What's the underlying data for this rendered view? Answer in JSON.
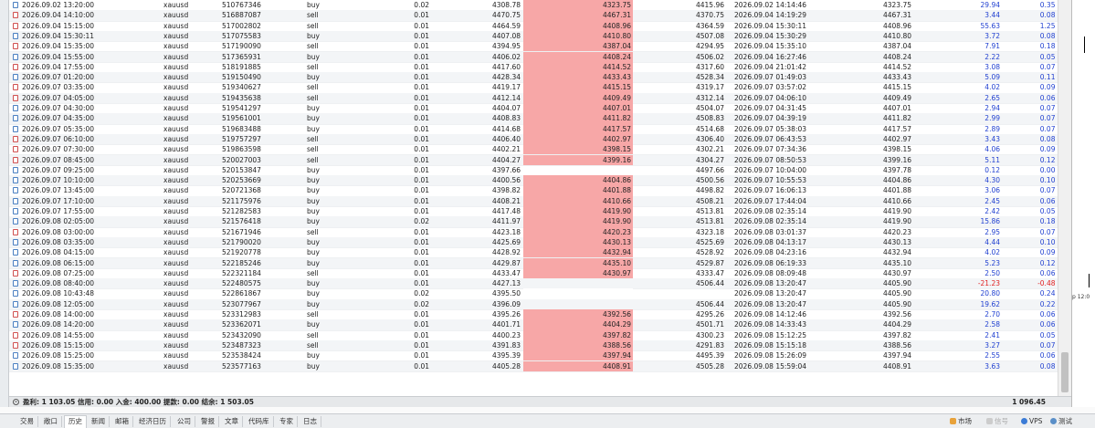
{
  "rows": [
    {
      "time": "2026.09.02 13:20:00",
      "symbol": "xauusd",
      "ticket": "510767346",
      "type": "buy",
      "volume": "0.02",
      "price": "4308.78",
      "sl": "4323.75",
      "tp": "4415.96",
      "ctime": "2026.09.02 14:14:46",
      "cprice": "4323.75",
      "profit": "29.94",
      "pct": "0.35 %",
      "hl": true
    },
    {
      "time": "2026.09.04 14:10:00",
      "symbol": "xauusd",
      "ticket": "516887087",
      "type": "sell",
      "volume": "0.01",
      "price": "4470.75",
      "sl": "4467.31",
      "tp": "4370.75",
      "ctime": "2026.09.04 14:19:29",
      "cprice": "4467.31",
      "profit": "3.44",
      "pct": "0.08 %",
      "hl": true
    },
    {
      "time": "2026.09.04 15:15:00",
      "symbol": "xauusd",
      "ticket": "517002802",
      "type": "sell",
      "volume": "0.01",
      "price": "4464.59",
      "sl": "4408.96",
      "tp": "4364.59",
      "ctime": "2026.09.04 15:30:11",
      "cprice": "4408.96",
      "profit": "55.63",
      "pct": "1.25 %",
      "hl": true
    },
    {
      "time": "2026.09.04 15:30:11",
      "symbol": "xauusd",
      "ticket": "517075583",
      "type": "buy",
      "volume": "0.01",
      "price": "4407.08",
      "sl": "4410.80",
      "tp": "4507.08",
      "ctime": "2026.09.04 15:30:29",
      "cprice": "4410.80",
      "profit": "3.72",
      "pct": "0.08 %",
      "hl": true
    },
    {
      "time": "2026.09.04 15:35:00",
      "symbol": "xauusd",
      "ticket": "517190090",
      "type": "sell",
      "volume": "0.01",
      "price": "4394.95",
      "sl": "4387.04",
      "tp": "4294.95",
      "ctime": "2026.09.04 15:35:10",
      "cprice": "4387.04",
      "profit": "7.91",
      "pct": "0.18 %",
      "hl": true
    },
    {
      "time": "2026.09.04 15:55:00",
      "symbol": "xauusd",
      "ticket": "517365931",
      "type": "buy",
      "volume": "0.01",
      "price": "4406.02",
      "sl": "4408.24",
      "tp": "4506.02",
      "ctime": "2026.09.04 16:27:46",
      "cprice": "4408.24",
      "profit": "2.22",
      "pct": "0.05 %",
      "hl": true
    },
    {
      "time": "2026.09.04 17:55:00",
      "symbol": "xauusd",
      "ticket": "518191885",
      "type": "sell",
      "volume": "0.01",
      "price": "4417.60",
      "sl": "4414.52",
      "tp": "4317.60",
      "ctime": "2026.09.04 21:01:42",
      "cprice": "4414.52",
      "profit": "3.08",
      "pct": "0.07 %",
      "hl": true
    },
    {
      "time": "2026.09.07 01:20:00",
      "symbol": "xauusd",
      "ticket": "519150490",
      "type": "buy",
      "volume": "0.01",
      "price": "4428.34",
      "sl": "4433.43",
      "tp": "4528.34",
      "ctime": "2026.09.07 01:49:03",
      "cprice": "4433.43",
      "profit": "5.09",
      "pct": "0.11 %",
      "hl": true
    },
    {
      "time": "2026.09.07 03:35:00",
      "symbol": "xauusd",
      "ticket": "519340627",
      "type": "sell",
      "volume": "0.01",
      "price": "4419.17",
      "sl": "4415.15",
      "tp": "4319.17",
      "ctime": "2026.09.07 03:57:02",
      "cprice": "4415.15",
      "profit": "4.02",
      "pct": "0.09 %",
      "hl": true
    },
    {
      "time": "2026.09.07 04:05:00",
      "symbol": "xauusd",
      "ticket": "519435638",
      "type": "sell",
      "volume": "0.01",
      "price": "4412.14",
      "sl": "4409.49",
      "tp": "4312.14",
      "ctime": "2026.09.07 04:06:10",
      "cprice": "4409.49",
      "profit": "2.65",
      "pct": "0.06 %",
      "hl": true
    },
    {
      "time": "2026.09.07 04:30:00",
      "symbol": "xauusd",
      "ticket": "519541297",
      "type": "buy",
      "volume": "0.01",
      "price": "4404.07",
      "sl": "4407.01",
      "tp": "4504.07",
      "ctime": "2026.09.07 04:31:45",
      "cprice": "4407.01",
      "profit": "2.94",
      "pct": "0.07 %",
      "hl": true
    },
    {
      "time": "2026.09.07 04:35:00",
      "symbol": "xauusd",
      "ticket": "519561001",
      "type": "buy",
      "volume": "0.01",
      "price": "4408.83",
      "sl": "4411.82",
      "tp": "4508.83",
      "ctime": "2026.09.07 04:39:19",
      "cprice": "4411.82",
      "profit": "2.99",
      "pct": "0.07 %",
      "hl": true
    },
    {
      "time": "2026.09.07 05:35:00",
      "symbol": "xauusd",
      "ticket": "519683488",
      "type": "buy",
      "volume": "0.01",
      "price": "4414.68",
      "sl": "4417.57",
      "tp": "4514.68",
      "ctime": "2026.09.07 05:38:03",
      "cprice": "4417.57",
      "profit": "2.89",
      "pct": "0.07 %",
      "hl": true
    },
    {
      "time": "2026.09.07 06:10:00",
      "symbol": "xauusd",
      "ticket": "519757297",
      "type": "sell",
      "volume": "0.01",
      "price": "4406.40",
      "sl": "4402.97",
      "tp": "4306.40",
      "ctime": "2026.09.07 06:43:53",
      "cprice": "4402.97",
      "profit": "3.43",
      "pct": "0.08 %",
      "hl": true
    },
    {
      "time": "2026.09.07 07:30:00",
      "symbol": "xauusd",
      "ticket": "519863598",
      "type": "sell",
      "volume": "0.01",
      "price": "4402.21",
      "sl": "4398.15",
      "tp": "4302.21",
      "ctime": "2026.09.07 07:34:36",
      "cprice": "4398.15",
      "profit": "4.06",
      "pct": "0.09 %",
      "hl": true
    },
    {
      "time": "2026.09.07 08:45:00",
      "symbol": "xauusd",
      "ticket": "520027003",
      "type": "sell",
      "volume": "0.01",
      "price": "4404.27",
      "sl": "4399.16",
      "tp": "4304.27",
      "ctime": "2026.09.07 08:50:53",
      "cprice": "4399.16",
      "profit": "5.11",
      "pct": "0.12 %",
      "hl": true
    },
    {
      "time": "2026.09.07 09:25:00",
      "symbol": "xauusd",
      "ticket": "520153847",
      "type": "buy",
      "volume": "0.01",
      "price": "4397.66",
      "sl": "",
      "tp": "4497.66",
      "ctime": "2026.09.07 10:04:00",
      "cprice": "4397.78",
      "profit": "0.12",
      "pct": "0.00 %",
      "hl": false
    },
    {
      "time": "2026.09.07 10:10:00",
      "symbol": "xauusd",
      "ticket": "520253669",
      "type": "buy",
      "volume": "0.01",
      "price": "4400.56",
      "sl": "4404.86",
      "tp": "4500.56",
      "ctime": "2026.09.07 10:55:53",
      "cprice": "4404.86",
      "profit": "4.30",
      "pct": "0.10 %",
      "hl": true
    },
    {
      "time": "2026.09.07 13:45:00",
      "symbol": "xauusd",
      "ticket": "520721368",
      "type": "buy",
      "volume": "0.01",
      "price": "4398.82",
      "sl": "4401.88",
      "tp": "4498.82",
      "ctime": "2026.09.07 16:06:13",
      "cprice": "4401.88",
      "profit": "3.06",
      "pct": "0.07 %",
      "hl": true
    },
    {
      "time": "2026.09.07 17:10:00",
      "symbol": "xauusd",
      "ticket": "521175976",
      "type": "buy",
      "volume": "0.01",
      "price": "4408.21",
      "sl": "4410.66",
      "tp": "4508.21",
      "ctime": "2026.09.07 17:44:04",
      "cprice": "4410.66",
      "profit": "2.45",
      "pct": "0.06 %",
      "hl": true
    },
    {
      "time": "2026.09.07 17:55:00",
      "symbol": "xauusd",
      "ticket": "521282583",
      "type": "buy",
      "volume": "0.01",
      "price": "4417.48",
      "sl": "4419.90",
      "tp": "4513.81",
      "ctime": "2026.09.08 02:35:14",
      "cprice": "4419.90",
      "profit": "2.42",
      "pct": "0.05 %",
      "hl": true
    },
    {
      "time": "2026.09.08 02:05:00",
      "symbol": "xauusd",
      "ticket": "521576418",
      "type": "buy",
      "volume": "0.02",
      "price": "4411.97",
      "sl": "4419.90",
      "tp": "4513.81",
      "ctime": "2026.09.08 02:35:14",
      "cprice": "4419.90",
      "profit": "15.86",
      "pct": "0.18 %",
      "hl": true
    },
    {
      "time": "2026.09.08 03:00:00",
      "symbol": "xauusd",
      "ticket": "521671946",
      "type": "sell",
      "volume": "0.01",
      "price": "4423.18",
      "sl": "4420.23",
      "tp": "4323.18",
      "ctime": "2026.09.08 03:01:37",
      "cprice": "4420.23",
      "profit": "2.95",
      "pct": "0.07 %",
      "hl": true
    },
    {
      "time": "2026.09.08 03:35:00",
      "symbol": "xauusd",
      "ticket": "521790020",
      "type": "buy",
      "volume": "0.01",
      "price": "4425.69",
      "sl": "4430.13",
      "tp": "4525.69",
      "ctime": "2026.09.08 04:13:17",
      "cprice": "4430.13",
      "profit": "4.44",
      "pct": "0.10 %",
      "hl": true
    },
    {
      "time": "2026.09.08 04:15:00",
      "symbol": "xauusd",
      "ticket": "521920778",
      "type": "buy",
      "volume": "0.01",
      "price": "4428.92",
      "sl": "4432.94",
      "tp": "4528.92",
      "ctime": "2026.09.08 04:23:16",
      "cprice": "4432.94",
      "profit": "4.02",
      "pct": "0.09 %",
      "hl": true
    },
    {
      "time": "2026.09.08 06:15:00",
      "symbol": "xauusd",
      "ticket": "522185246",
      "type": "buy",
      "volume": "0.01",
      "price": "4429.87",
      "sl": "4435.10",
      "tp": "4529.87",
      "ctime": "2026.09.08 06:19:33",
      "cprice": "4435.10",
      "profit": "5.23",
      "pct": "0.12 %",
      "hl": true
    },
    {
      "time": "2026.09.08 07:25:00",
      "symbol": "xauusd",
      "ticket": "522321184",
      "type": "sell",
      "volume": "0.01",
      "price": "4433.47",
      "sl": "4430.97",
      "tp": "4333.47",
      "ctime": "2026.09.08 08:09:48",
      "cprice": "4430.97",
      "profit": "2.50",
      "pct": "0.06 %",
      "hl": true
    },
    {
      "time": "2026.09.08 08:40:00",
      "symbol": "xauusd",
      "ticket": "522480575",
      "type": "buy",
      "volume": "0.01",
      "price": "4427.13",
      "sl": "",
      "tp": "4506.44",
      "ctime": "2026.09.08 13:20:47",
      "cprice": "4405.90",
      "profit": "-21.23",
      "pct": "-0.48 %",
      "hl": false,
      "neg": true
    },
    {
      "time": "2026.09.08 10:43:48",
      "symbol": "xauusd",
      "ticket": "522861867",
      "type": "buy",
      "volume": "0.02",
      "price": "4395.50",
      "sl": "",
      "tp": "",
      "ctime": "2026.09.08 13:20:47",
      "cprice": "4405.90",
      "profit": "20.80",
      "pct": "0.24 %",
      "hl": false,
      "wh": true
    },
    {
      "time": "2026.09.08 12:05:00",
      "symbol": "xauusd",
      "ticket": "523077967",
      "type": "buy",
      "volume": "0.02",
      "price": "4396.09",
      "sl": "",
      "tp": "4506.44",
      "ctime": "2026.09.08 13:20:47",
      "cprice": "4405.90",
      "profit": "19.62",
      "pct": "0.22 %",
      "hl": false
    },
    {
      "time": "2026.09.08 14:00:00",
      "symbol": "xauusd",
      "ticket": "523312983",
      "type": "sell",
      "volume": "0.01",
      "price": "4395.26",
      "sl": "4392.56",
      "tp": "4295.26",
      "ctime": "2026.09.08 14:12:46",
      "cprice": "4392.56",
      "profit": "2.70",
      "pct": "0.06 %",
      "hl": true
    },
    {
      "time": "2026.09.08 14:20:00",
      "symbol": "xauusd",
      "ticket": "523362071",
      "type": "buy",
      "volume": "0.01",
      "price": "4401.71",
      "sl": "4404.29",
      "tp": "4501.71",
      "ctime": "2026.09.08 14:33:43",
      "cprice": "4404.29",
      "profit": "2.58",
      "pct": "0.06 %",
      "hl": true
    },
    {
      "time": "2026.09.08 14:55:00",
      "symbol": "xauusd",
      "ticket": "523432090",
      "type": "sell",
      "volume": "0.01",
      "price": "4400.23",
      "sl": "4397.82",
      "tp": "4300.23",
      "ctime": "2026.09.08 15:12:25",
      "cprice": "4397.82",
      "profit": "2.41",
      "pct": "0.05 %",
      "hl": true
    },
    {
      "time": "2026.09.08 15:15:00",
      "symbol": "xauusd",
      "ticket": "523487323",
      "type": "sell",
      "volume": "0.01",
      "price": "4391.83",
      "sl": "4388.56",
      "tp": "4291.83",
      "ctime": "2026.09.08 15:15:18",
      "cprice": "4388.56",
      "profit": "3.27",
      "pct": "0.07 %",
      "hl": true
    },
    {
      "time": "2026.09.08 15:25:00",
      "symbol": "xauusd",
      "ticket": "523538424",
      "type": "buy",
      "volume": "0.01",
      "price": "4395.39",
      "sl": "4397.94",
      "tp": "4495.39",
      "ctime": "2026.09.08 15:26:09",
      "cprice": "4397.94",
      "profit": "2.55",
      "pct": "0.06 %",
      "hl": true
    },
    {
      "time": "2026.09.08 15:35:00",
      "symbol": "xauusd",
      "ticket": "523577163",
      "type": "buy",
      "volume": "0.01",
      "price": "4405.28",
      "sl": "4408.91",
      "tp": "4505.28",
      "ctime": "2026.09.08 15:59:04",
      "cprice": "4408.91",
      "profit": "3.63",
      "pct": "0.08 %",
      "hl": true
    }
  ],
  "summary": {
    "text": "盈利: 1 103.05  信用: 0.00  入金: 400.00  提款: 0.00  结余: 1 503.05",
    "total": "1 096.45"
  },
  "chart_strip": {
    "label": "p 12:0"
  },
  "tabs": [
    "交易",
    "敞口",
    "历史",
    "新闻",
    "邮箱",
    "经济日历",
    "公司",
    "警报",
    "文章",
    "代码库",
    "专家",
    "日志"
  ],
  "active_tab": 2,
  "right_status": {
    "market": "市场",
    "signal": "信号",
    "vps": "VPS",
    "test": "测试"
  },
  "colors": {
    "highlight": "#f7a7a7",
    "profit": "#1f3fd0",
    "loss": "#e02020"
  }
}
